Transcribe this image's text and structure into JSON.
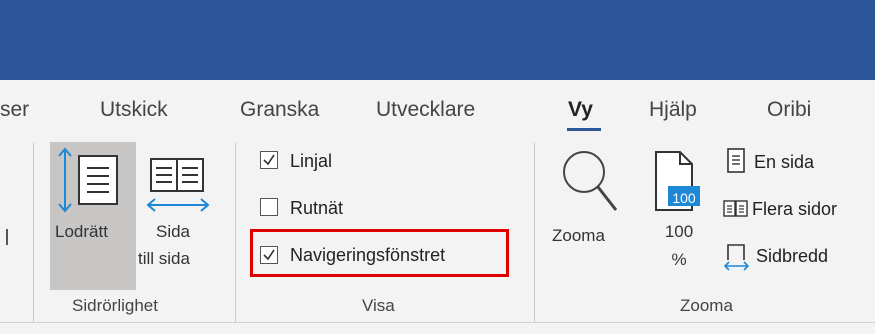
{
  "tabs": [
    {
      "label": "ser"
    },
    {
      "label": "Utskick"
    },
    {
      "label": "Granska"
    },
    {
      "label": "Utvecklare"
    },
    {
      "label": "Vy"
    },
    {
      "label": "Hjälp"
    },
    {
      "label": "Oribi"
    }
  ],
  "active_tab": "Vy",
  "groups": {
    "sidrorlighet": {
      "label": "Sidrörlighet",
      "vertical_label": "Lodrätt",
      "side_label_1": "Sida",
      "side_label_2": "till sida"
    },
    "visa": {
      "label": "Visa",
      "ruler": {
        "label": "Linjal",
        "checked": true
      },
      "gridlines": {
        "label": "Rutnät",
        "checked": false
      },
      "navpane": {
        "label": "Navigeringsfönstret",
        "checked": true
      }
    },
    "zooma": {
      "label": "Zooma",
      "zoom_label": "Zooma",
      "hundred_label_1": "100",
      "hundred_label_2": "%",
      "hundred_badge": "100",
      "one_page": "En sida",
      "multiple_pages": "Flera sidor",
      "page_width": "Sidbredd"
    }
  },
  "colors": {
    "title_bar": "#2b579a",
    "accent": "#2b579a",
    "highlight_border": "#e00000"
  }
}
